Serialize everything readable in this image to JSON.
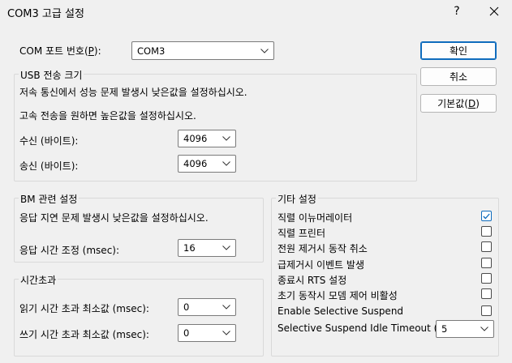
{
  "window": {
    "title": "COM3 고급 설정",
    "help_label": "?",
    "close_label": "✕"
  },
  "port": {
    "label": "COM 포트 번호(P):",
    "value": "COM3"
  },
  "buttons": {
    "ok": "확인",
    "cancel": "취소",
    "defaults": "기본값(D)"
  },
  "usb": {
    "title": "USB 전송 크기",
    "hint1": "저속 통신에서 성능 문제 발생시 낮은값을 설정하십시오.",
    "hint2": "고속 전송을 원하면 높은값을 설정하십시오.",
    "receive_label": "수신 (바이트):",
    "receive_value": "4096",
    "transmit_label": "송신 (바이트):",
    "transmit_value": "4096"
  },
  "bm": {
    "title": "BM 관련 설정",
    "hint": "응답 지연 문제 발생시 낮은값을 설정하십시오.",
    "latency_label": "응답 시간 조정 (msec):",
    "latency_value": "16"
  },
  "timeouts": {
    "title": "시간초과",
    "read_label": "읽기 시간 초과 최소값 (msec):",
    "read_value": "0",
    "write_label": "쓰기 시간 초과 최소값 (msec):",
    "write_value": "0"
  },
  "misc": {
    "title": "기타 설정",
    "options": [
      {
        "label": "직렬 이뉴머레이터",
        "checked": true
      },
      {
        "label": "직렬 프린터",
        "checked": false
      },
      {
        "label": "전원 제거시 동작 취소",
        "checked": false
      },
      {
        "label": "급제거시 이벤트 발생",
        "checked": false
      },
      {
        "label": "종료시 RTS 설정",
        "checked": false
      },
      {
        "label": "초기 동작시 모뎀 제어 비활성",
        "checked": false
      },
      {
        "label": "Enable Selective Suspend",
        "checked": false
      }
    ],
    "idle_timeout_label": "Selective Suspend Idle Timeout (secs):",
    "idle_timeout_value": "5"
  },
  "colors": {
    "accent": "#0f6cbd",
    "background": "#f0f0f0"
  }
}
